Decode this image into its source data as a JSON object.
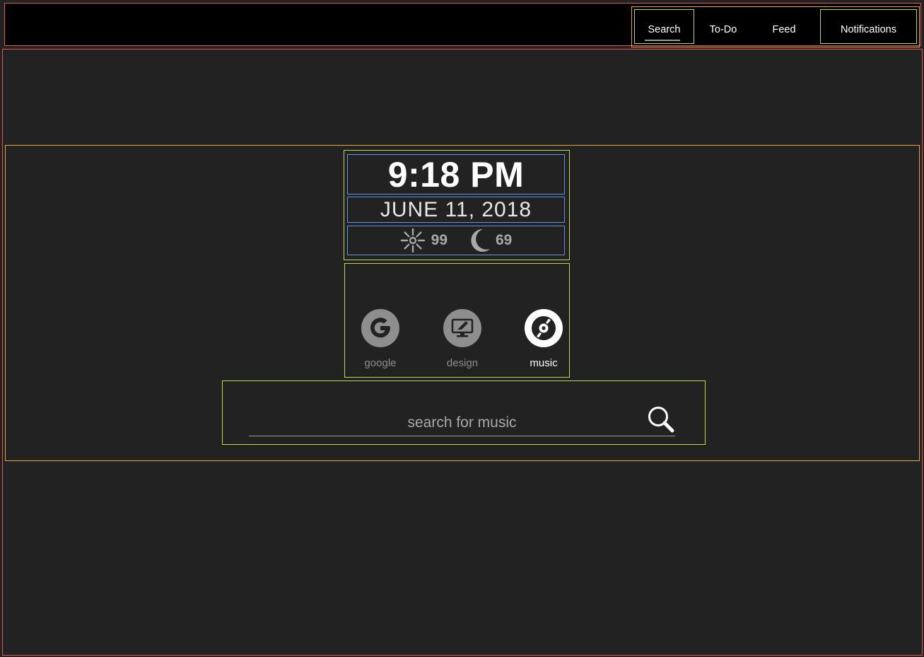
{
  "nav": {
    "items": [
      {
        "label": "Search"
      },
      {
        "label": "To-Do"
      },
      {
        "label": "Feed"
      },
      {
        "label": "Notifications"
      }
    ]
  },
  "clock": {
    "time": "9:18 PM",
    "date": "JUNE 11, 2018",
    "weather": {
      "high": "99",
      "high_icon": "sun-icon",
      "low": "69",
      "low_icon": "moon-icon"
    }
  },
  "tiles": [
    {
      "label": "google",
      "icon": "google-icon",
      "active": false
    },
    {
      "label": "design",
      "icon": "design-monitor-icon",
      "active": false
    },
    {
      "label": "music",
      "icon": "music-disc-icon",
      "active": true
    }
  ],
  "search": {
    "placeholder": "search for music",
    "value": "",
    "icon": "search-icon"
  },
  "colors": {
    "topbar": "#000000",
    "background": "#222222",
    "tile_inactive": "#8e8e8e",
    "tile_active": "#ffffff"
  }
}
